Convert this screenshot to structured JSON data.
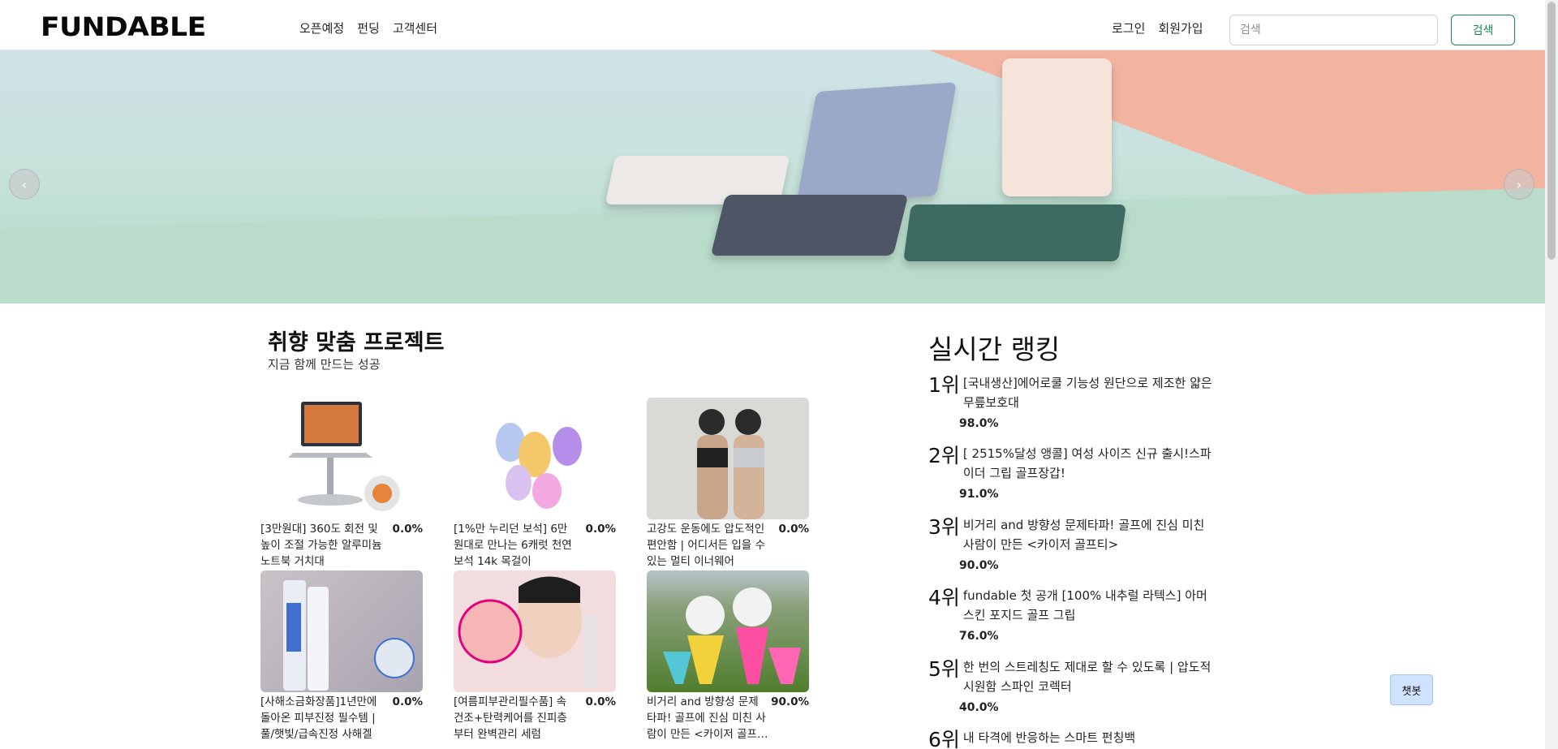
{
  "header": {
    "logo": "FUNDABLE",
    "nav": [
      "오픈예정",
      "펀딩",
      "고객센터"
    ],
    "login": "로그인",
    "signup": "회원가입",
    "search_placeholder": "검색",
    "search_button": "검색"
  },
  "banner": {
    "prev_icon": "chevron-left-icon",
    "next_icon": "chevron-right-icon"
  },
  "recommend": {
    "title": "취향 맞춤 프로젝트",
    "subtitle": "지금 함께 만드는 성공",
    "cards": [
      {
        "name": "[3만원대] 360도 회전 및 높이 조절 가능한 알루미늄 노트북 거치대",
        "percent": "0.0%"
      },
      {
        "name": "[1%만 누리던 보석] 6만원대로 만나는 6캐럿 천연보석 14k 목걸이",
        "percent": "0.0%"
      },
      {
        "name": "고강도 운동에도 압도적인 편안함 | 어디서든 입을 수 있는 멀티 이너웨어",
        "percent": "0.0%"
      },
      {
        "name": "[사해소금화장품]1년만에 돌아온 피부진정 필수템 | 풀/햇빛/급속진정 사해겔",
        "percent": "0.0%"
      },
      {
        "name": "[여름피부관리필수품] 속건조+탄력케어를 진피층부터 완벽관리 세럼",
        "percent": "0.0%"
      },
      {
        "name": "비거리 and 방향성 문제타파! 골프에 진심 미친 사람이 만든 <카이저 골프티>",
        "percent": "90.0%"
      }
    ]
  },
  "ranking": {
    "title": "실시간 랭킹",
    "items": [
      {
        "rank": "1위",
        "text": "[국내생산]에어로쿨 기능성 원단으로 제조한 얇은 무릎보호대",
        "percent": "98.0%"
      },
      {
        "rank": "2위",
        "text": "[ 2515%달성 앵콜] 여성 사이즈 신규 출시!스파이더 그립 골프장갑!",
        "percent": "91.0%"
      },
      {
        "rank": "3위",
        "text": "비거리 and 방향성 문제타파! 골프에 진심 미친 사람이 만든 <카이저 골프티>",
        "percent": "90.0%"
      },
      {
        "rank": "4위",
        "text": "fundable 첫 공개 [100% 내추럴 라텍스] 아머스킨 포지드 골프 그립",
        "percent": "76.0%"
      },
      {
        "rank": "5위",
        "text": "한 번의 스트레칭도 제대로 할 수 있도록 | 압도적 시원함 스파인 코렉터",
        "percent": "40.0%"
      },
      {
        "rank": "6위",
        "text": "내 타격에 반응하는 스마트 펀칭백",
        "percent": ""
      }
    ]
  },
  "chatbot": "챗봇"
}
